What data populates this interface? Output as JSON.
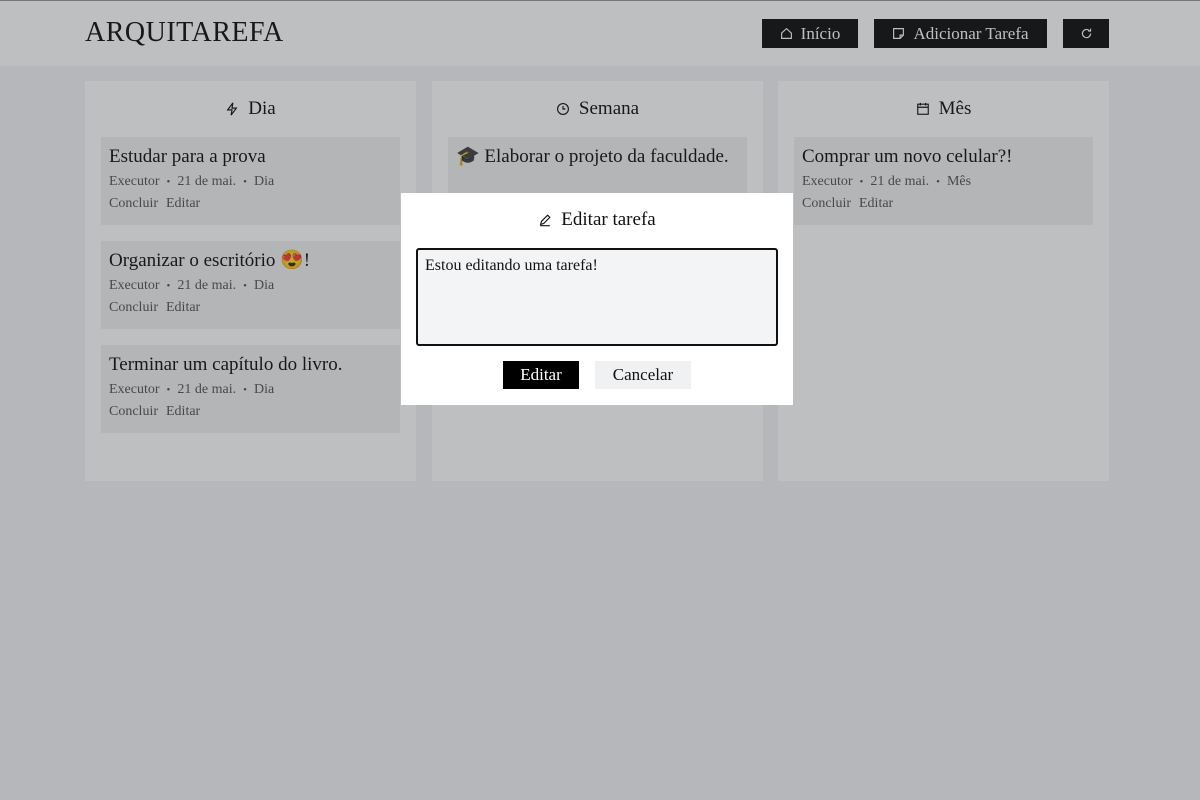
{
  "header": {
    "logo": "ARQUITAREFA",
    "home_label": "Início",
    "add_label": "Adicionar Tarefa"
  },
  "columns": [
    {
      "title": "Dia",
      "icon": "lightning-icon",
      "cards": [
        {
          "title": "Estudar para a prova",
          "executor": "Executor",
          "date": "21 de mai.",
          "period": "Dia",
          "complete": "Concluir",
          "edit": "Editar"
        },
        {
          "title": "Organizar o escritório 😍!",
          "executor": "Executor",
          "date": "21 de mai.",
          "period": "Dia",
          "complete": "Concluir",
          "edit": "Editar"
        },
        {
          "title": "Terminar um capítulo do livro.",
          "executor": "Executor",
          "date": "21 de mai.",
          "period": "Dia",
          "complete": "Concluir",
          "edit": "Editar"
        }
      ]
    },
    {
      "title": "Semana",
      "icon": "clock-icon",
      "cards": [
        {
          "title": "🎓 Elaborar o projeto da faculdade."
        }
      ]
    },
    {
      "title": "Mês",
      "icon": "calendar-icon",
      "cards": [
        {
          "title": "Comprar um novo celular?!",
          "executor": "Executor",
          "date": "21 de mai.",
          "period": "Mês",
          "complete": "Concluir",
          "edit": "Editar"
        }
      ]
    }
  ],
  "modal": {
    "title": "Editar tarefa",
    "textarea_value": "Estou editando uma tarefa!",
    "edit_label": "Editar",
    "cancel_label": "Cancelar"
  }
}
